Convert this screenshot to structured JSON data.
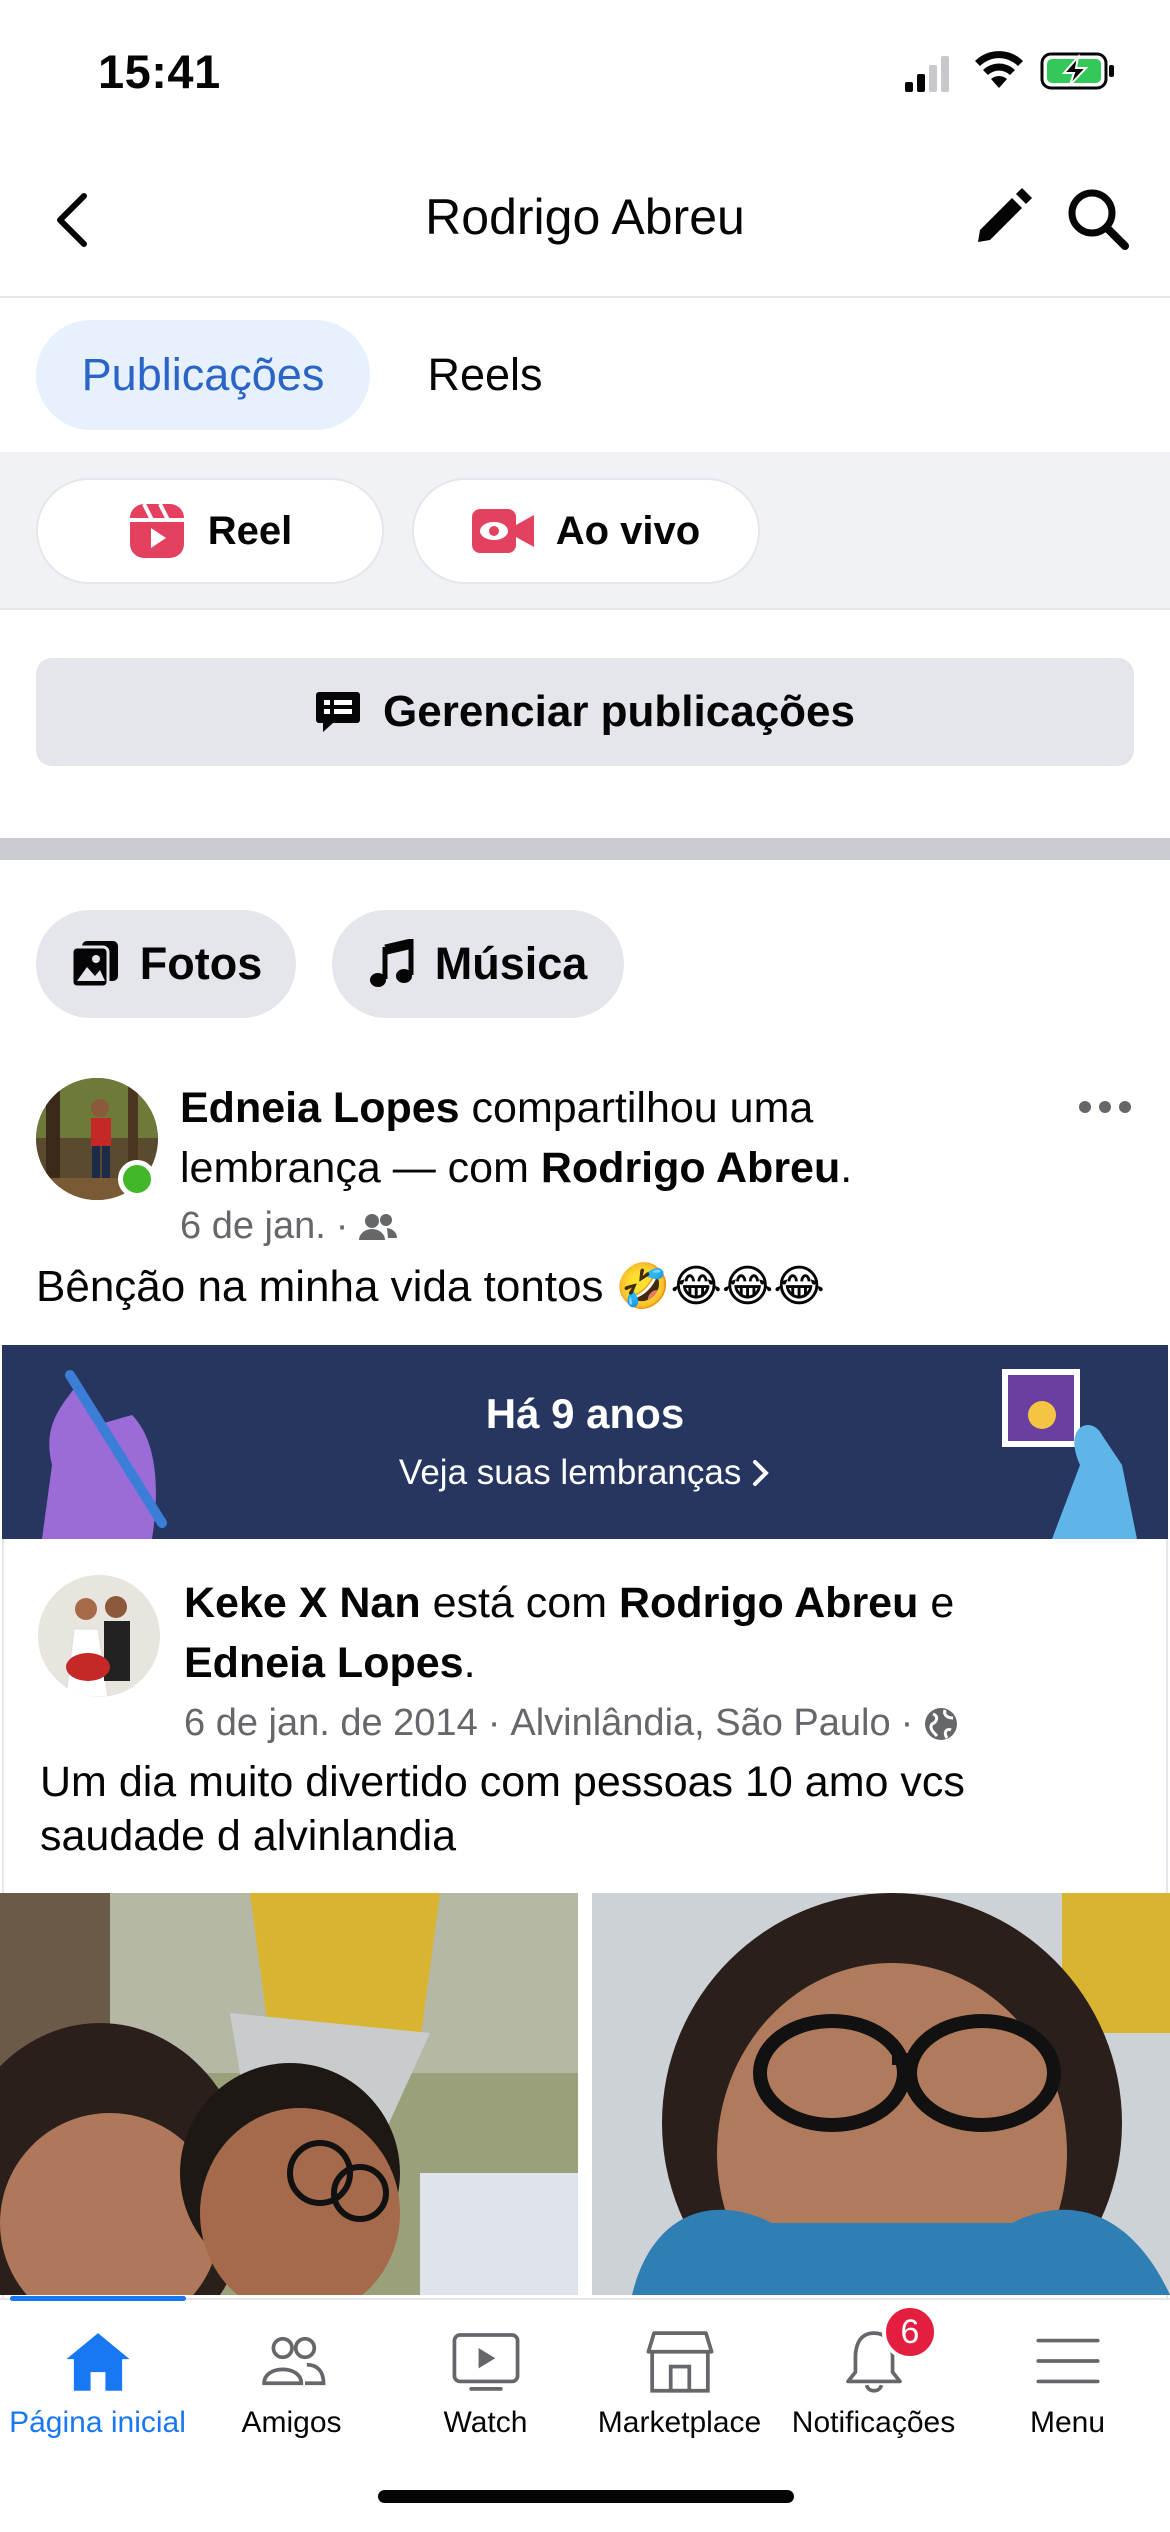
{
  "status_bar": {
    "time": "15:41",
    "battery_state": "charging",
    "battery_color": "#34c759"
  },
  "header": {
    "title": "Rodrigo Abreu",
    "back_icon": "chevron-left-icon",
    "edit_icon": "pencil-icon",
    "search_icon": "search-icon"
  },
  "tabs": [
    {
      "label": "Publicações",
      "selected": true
    },
    {
      "label": "Reels",
      "selected": false
    }
  ],
  "create_actions": [
    {
      "label": "Reel",
      "icon": "reel-icon"
    },
    {
      "label": "Ao vivo",
      "icon": "live-video-icon"
    }
  ],
  "manage_button": {
    "label": "Gerenciar publicações",
    "icon": "manage-posts-icon"
  },
  "filter_chips": [
    {
      "label": "Fotos",
      "icon": "photos-icon"
    },
    {
      "label": "Música",
      "icon": "music-icon"
    }
  ],
  "post": {
    "author": "Edneia Lopes",
    "action": "compartilhou uma lembrança — com",
    "tagged": "Rodrigo Abreu",
    "date": "6 de jan.",
    "audience_icon": "friends-icon",
    "text": "Bênção  na minha vida   tontos 🤣😂😂😂",
    "memory_banner": {
      "title": "Há 9 anos",
      "subtitle": "Veja suas lembranças"
    },
    "shared": {
      "author": "Keke X Nan",
      "action": "está com",
      "tagged_1": "Rodrigo Abreu",
      "conjunction": "e",
      "tagged_2": "Edneia Lopes",
      "date": "6 de jan. de 2014",
      "location": "Alvinlândia, São Paulo",
      "audience_icon": "globe-icon",
      "text": "Um dia muito divertido com pessoas 10 amo vcs saudade d alvinlandia"
    }
  },
  "bottom_nav": [
    {
      "label": "Página inicial",
      "icon": "home-icon",
      "active": true
    },
    {
      "label": "Amigos",
      "icon": "friends-icon",
      "active": false
    },
    {
      "label": "Watch",
      "icon": "watch-icon",
      "active": false
    },
    {
      "label": "Marketplace",
      "icon": "marketplace-icon",
      "active": false
    },
    {
      "label": "Notificações",
      "icon": "bell-icon",
      "active": false,
      "badge": "6"
    },
    {
      "label": "Menu",
      "icon": "menu-icon",
      "active": false
    }
  ],
  "colors": {
    "accent": "#1877f2",
    "tab_selected_bg": "#e7f0fd",
    "tab_selected_text": "#2a64c6",
    "memory_bg": "#263660",
    "badge": "#e41e3f"
  }
}
